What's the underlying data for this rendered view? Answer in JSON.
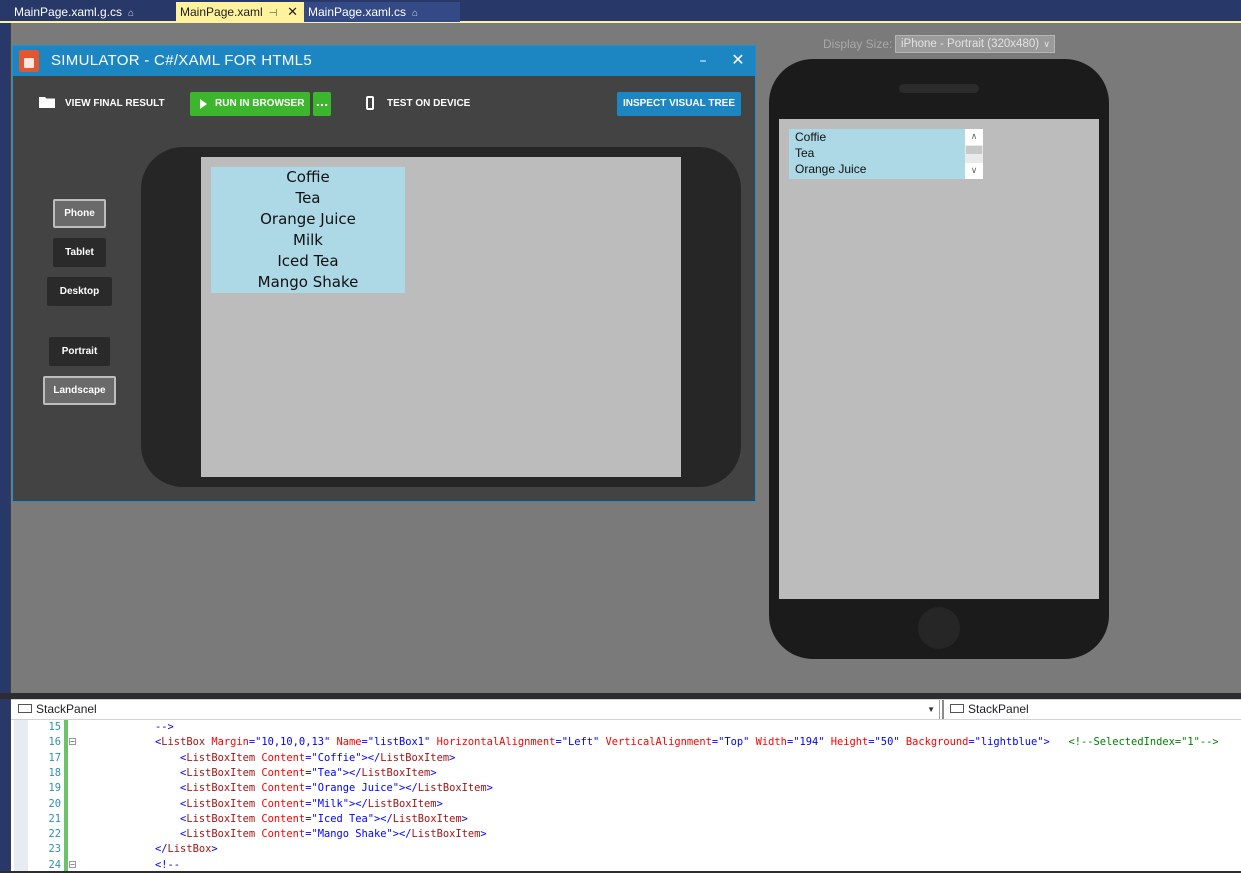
{
  "tabs": [
    {
      "label": "MainPage.xaml.g.cs",
      "icon": "lock-icon"
    },
    {
      "label": "MainPage.xaml",
      "icon": "pin-icon",
      "active": true
    },
    {
      "label": "MainPage.xaml.cs",
      "icon": "lock-icon"
    }
  ],
  "simulator": {
    "title": "SIMULATOR - C#/XAML FOR HTML5",
    "toolbar": {
      "view_final": "VIEW FINAL RESULT",
      "run_in_browser": "RUN IN BROWSER",
      "run_more": "...",
      "test_on_device": "TEST ON DEVICE",
      "inspect_visual_tree": "INSPECT VISUAL TREE"
    },
    "device_buttons": [
      "Phone",
      "Tablet",
      "Desktop"
    ],
    "orientation_buttons": [
      "Portrait",
      "Landscape"
    ],
    "selected_device": "Phone",
    "selected_orientation": "Landscape",
    "listbox_items": [
      "Coffie",
      "Tea",
      "Orange Juice",
      "Milk",
      "Iced Tea",
      "Mango Shake"
    ]
  },
  "display_size": {
    "label": "Display Size:",
    "value": "iPhone - Portrait (320x480)"
  },
  "preview_listbox": {
    "visible_items": [
      "Coffie",
      "Tea",
      "Orange Juice"
    ],
    "background": "#add8e6"
  },
  "nav": {
    "left": "StackPanel",
    "right": "StackPanel"
  },
  "code": {
    "lines": [
      {
        "num": "15",
        "indent": "    ",
        "parts": [
          [
            "c-blue",
            "-->"
          ]
        ]
      },
      {
        "num": "16",
        "indent": "    ",
        "fold": true,
        "parts": [
          [
            "c-blue",
            "<"
          ],
          [
            "c-maroon",
            "ListBox"
          ],
          [
            "c-red",
            " Margin"
          ],
          [
            "c-blue",
            "=\"10,10,0,13\""
          ],
          [
            "c-red",
            " Name"
          ],
          [
            "c-blue",
            "=\"listBox1\""
          ],
          [
            "c-red",
            " HorizontalAlignment"
          ],
          [
            "c-blue",
            "=\"Left\""
          ],
          [
            "c-red",
            " VerticalAlignment"
          ],
          [
            "c-blue",
            "=\"Top\""
          ],
          [
            "c-red",
            " Width"
          ],
          [
            "c-blue",
            "=\"194\""
          ],
          [
            "c-red",
            " Height"
          ],
          [
            "c-blue",
            "=\"50\""
          ],
          [
            "c-red",
            " Background"
          ],
          [
            "c-blue",
            "=\"lightblue\">"
          ],
          [
            "c-green",
            "   <!--SelectedIndex=\"1\"-->"
          ]
        ]
      },
      {
        "num": "17",
        "indent": "        ",
        "parts": [
          [
            "c-blue",
            "<"
          ],
          [
            "c-maroon",
            "ListBoxItem"
          ],
          [
            "c-red",
            " Content"
          ],
          [
            "c-blue",
            "=\"Coffie\"></"
          ],
          [
            "c-maroon",
            "ListBoxItem"
          ],
          [
            "c-blue",
            ">"
          ]
        ]
      },
      {
        "num": "18",
        "indent": "        ",
        "parts": [
          [
            "c-blue",
            "<"
          ],
          [
            "c-maroon",
            "ListBoxItem"
          ],
          [
            "c-red",
            " Content"
          ],
          [
            "c-blue",
            "=\"Tea\"></"
          ],
          [
            "c-maroon",
            "ListBoxItem"
          ],
          [
            "c-blue",
            ">"
          ]
        ]
      },
      {
        "num": "19",
        "indent": "        ",
        "parts": [
          [
            "c-blue",
            "<"
          ],
          [
            "c-maroon",
            "ListBoxItem"
          ],
          [
            "c-red",
            " Content"
          ],
          [
            "c-blue",
            "=\"Orange Juice\"></"
          ],
          [
            "c-maroon",
            "ListBoxItem"
          ],
          [
            "c-blue",
            ">"
          ]
        ]
      },
      {
        "num": "20",
        "indent": "        ",
        "parts": [
          [
            "c-blue",
            "<"
          ],
          [
            "c-maroon",
            "ListBoxItem"
          ],
          [
            "c-red",
            " Content"
          ],
          [
            "c-blue",
            "=\"Milk\"></"
          ],
          [
            "c-maroon",
            "ListBoxItem"
          ],
          [
            "c-blue",
            ">"
          ]
        ]
      },
      {
        "num": "21",
        "indent": "        ",
        "parts": [
          [
            "c-blue",
            "<"
          ],
          [
            "c-maroon",
            "ListBoxItem"
          ],
          [
            "c-red",
            " Content"
          ],
          [
            "c-blue",
            "=\"Iced Tea\"></"
          ],
          [
            "c-maroon",
            "ListBoxItem"
          ],
          [
            "c-blue",
            ">"
          ]
        ]
      },
      {
        "num": "22",
        "indent": "        ",
        "parts": [
          [
            "c-blue",
            "<"
          ],
          [
            "c-maroon",
            "ListBoxItem"
          ],
          [
            "c-red",
            " Content"
          ],
          [
            "c-blue",
            "=\"Mango Shake\"></"
          ],
          [
            "c-maroon",
            "ListBoxItem"
          ],
          [
            "c-blue",
            ">"
          ]
        ]
      },
      {
        "num": "23",
        "indent": "    ",
        "parts": [
          [
            "c-blue",
            "</"
          ],
          [
            "c-maroon",
            "ListBox"
          ],
          [
            "c-blue",
            ">"
          ]
        ]
      },
      {
        "num": "24",
        "indent": "    ",
        "fold": true,
        "parts": [
          [
            "c-blue",
            "<!--"
          ]
        ]
      }
    ]
  },
  "colors": {
    "accent_blue": "#1c86c2",
    "run_green": "#3cb62c",
    "active_tab": "#fff29d"
  }
}
